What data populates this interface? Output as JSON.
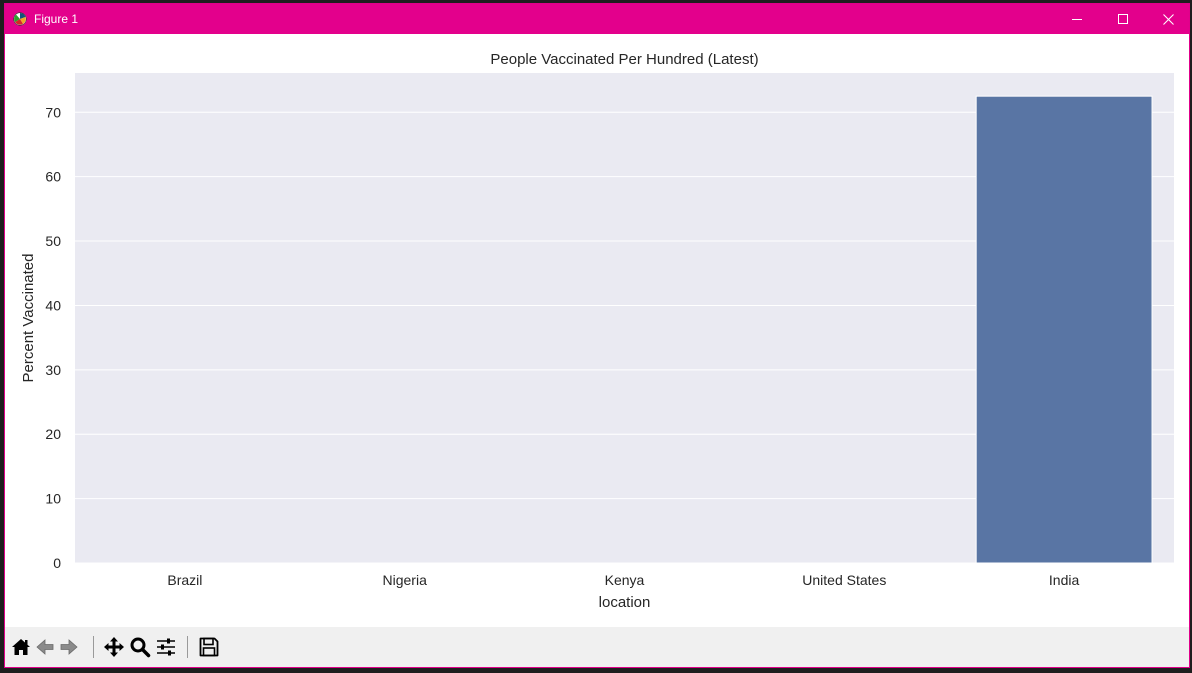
{
  "window": {
    "title": "Figure 1",
    "accent_color": "#e3008c",
    "controls": [
      "minimize-icon",
      "maximize-icon",
      "close-icon"
    ]
  },
  "chart_data": {
    "type": "bar",
    "title": "People Vaccinated Per Hundred (Latest)",
    "xlabel": "location",
    "ylabel": "Percent Vaccinated",
    "categories": [
      "Brazil",
      "Nigeria",
      "Kenya",
      "United States",
      "India"
    ],
    "values": [
      0,
      0,
      0,
      0,
      72.5
    ],
    "ylim": [
      0,
      76.1
    ],
    "yticks": [
      0,
      10,
      20,
      30,
      40,
      50,
      60,
      70
    ],
    "grid": true,
    "bar_color": "#5975a4",
    "background_color": "#eaeaf2",
    "legend": "none"
  },
  "toolbar": {
    "tools": [
      "home-icon",
      "back-arrow-icon",
      "forward-arrow-icon",
      "pan-icon",
      "zoom-icon",
      "configure-subplots-icon",
      "save-icon"
    ]
  }
}
